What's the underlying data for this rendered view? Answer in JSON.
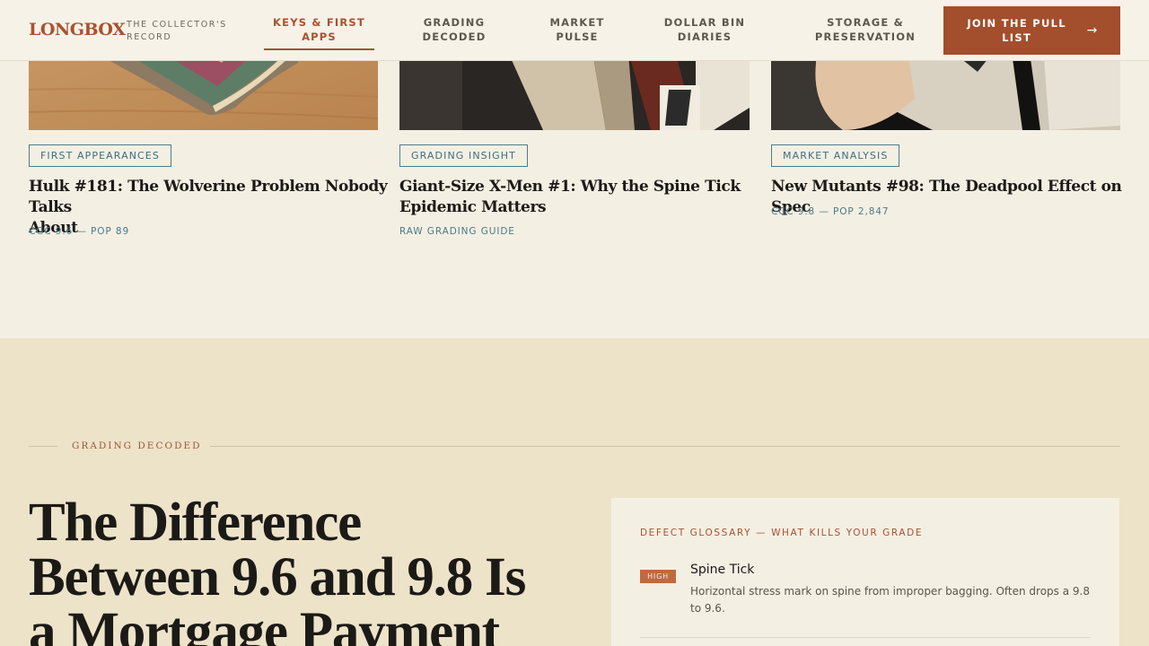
{
  "brand": {
    "logo": "LONGBOX",
    "tagline_line1": "THE COLLECTOR'S",
    "tagline_line2": "RECORD"
  },
  "nav": {
    "items": [
      {
        "line1": "KEYS & FIRST",
        "line2": "APPS",
        "active": true
      },
      {
        "line1": "GRADING",
        "line2": "DECODED",
        "active": false
      },
      {
        "line1": "MARKET",
        "line2": "PULSE",
        "active": false
      },
      {
        "line1": "DOLLAR BIN",
        "line2": "DIARIES",
        "active": false
      },
      {
        "line1": "STORAGE &",
        "line2": "PRESERVATION",
        "active": false
      }
    ],
    "cta": {
      "line1": "JOIN THE PULL",
      "line2": "LIST",
      "arrow": "→"
    }
  },
  "articles": [
    {
      "tag": "FIRST APPEARANCES",
      "title_line1": "Hulk #181: The Wolverine Problem Nobody Talks",
      "title_line2": "About",
      "meta": "CGC 9.6 — POP 89"
    },
    {
      "tag": "GRADING INSIGHT",
      "title_line1": "Giant-Size X-Men #1: Why the Spine Tick",
      "title_line2": "Epidemic Matters",
      "meta": "RAW GRADING GUIDE"
    },
    {
      "tag": "MARKET ANALYSIS",
      "title_line1": "New Mutants #98: The Deadpool Effect on Spec",
      "title_line2": "",
      "meta": "CGC 9.8 — POP 2,847"
    }
  ],
  "section": {
    "eyebrow": "GRADING DECODED",
    "headline_line1": "The Difference",
    "headline_line2": "Between 9.6 and 9.8 Is",
    "headline_line3": "a Mortgage Payment"
  },
  "glossary": {
    "title": "DEFECT GLOSSARY — WHAT KILLS YOUR GRADE",
    "items": [
      {
        "severity": "HIGH",
        "name": "Spine Tick",
        "desc_line1": "Horizontal stress mark on spine from improper bagging. Often drops a 9.8",
        "desc_line2": "to 9.6."
      }
    ]
  },
  "colors": {
    "accent": "#a8522f",
    "teal": "#3f6e7c",
    "band": "#ece3c9",
    "paper": "#f4efe3"
  }
}
